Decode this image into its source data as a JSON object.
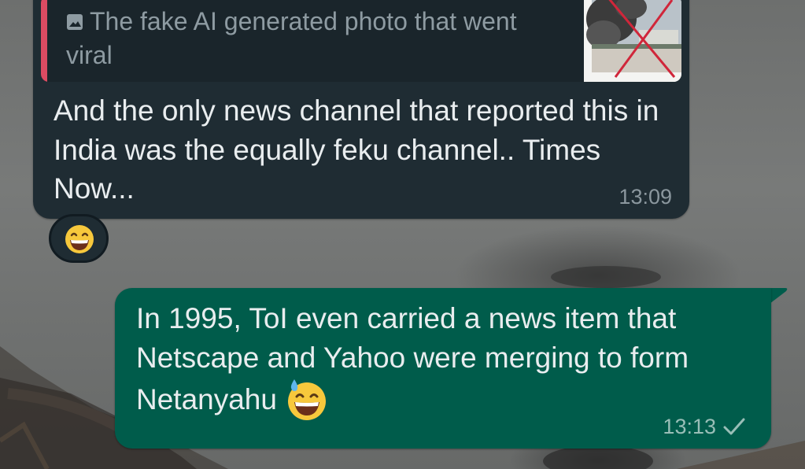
{
  "colors": {
    "incoming_bubble": "#1f2c33",
    "outgoing_bubble": "#005c4b",
    "quote_accent": "#dc4b62",
    "message_text": "#e9edef",
    "timestamp_in": "#8b979e",
    "timestamp_out": "#99beb7"
  },
  "incoming": {
    "quote": {
      "icon": "photo-icon",
      "text": "The fake AI generated photo that went viral"
    },
    "text": "And the only news channel that reported this in India was the equally feku channel.. Times Now...",
    "time": "13:09",
    "reaction": {
      "icon": "grinning-face-emoji"
    }
  },
  "outgoing": {
    "text": "In 1995, ToI even carried a news item that Netscape and Yahoo were merging to form Netanyahu",
    "emoji": "grinning-sweat-emoji",
    "time": "13:13",
    "status_icon": "single-check-icon"
  }
}
